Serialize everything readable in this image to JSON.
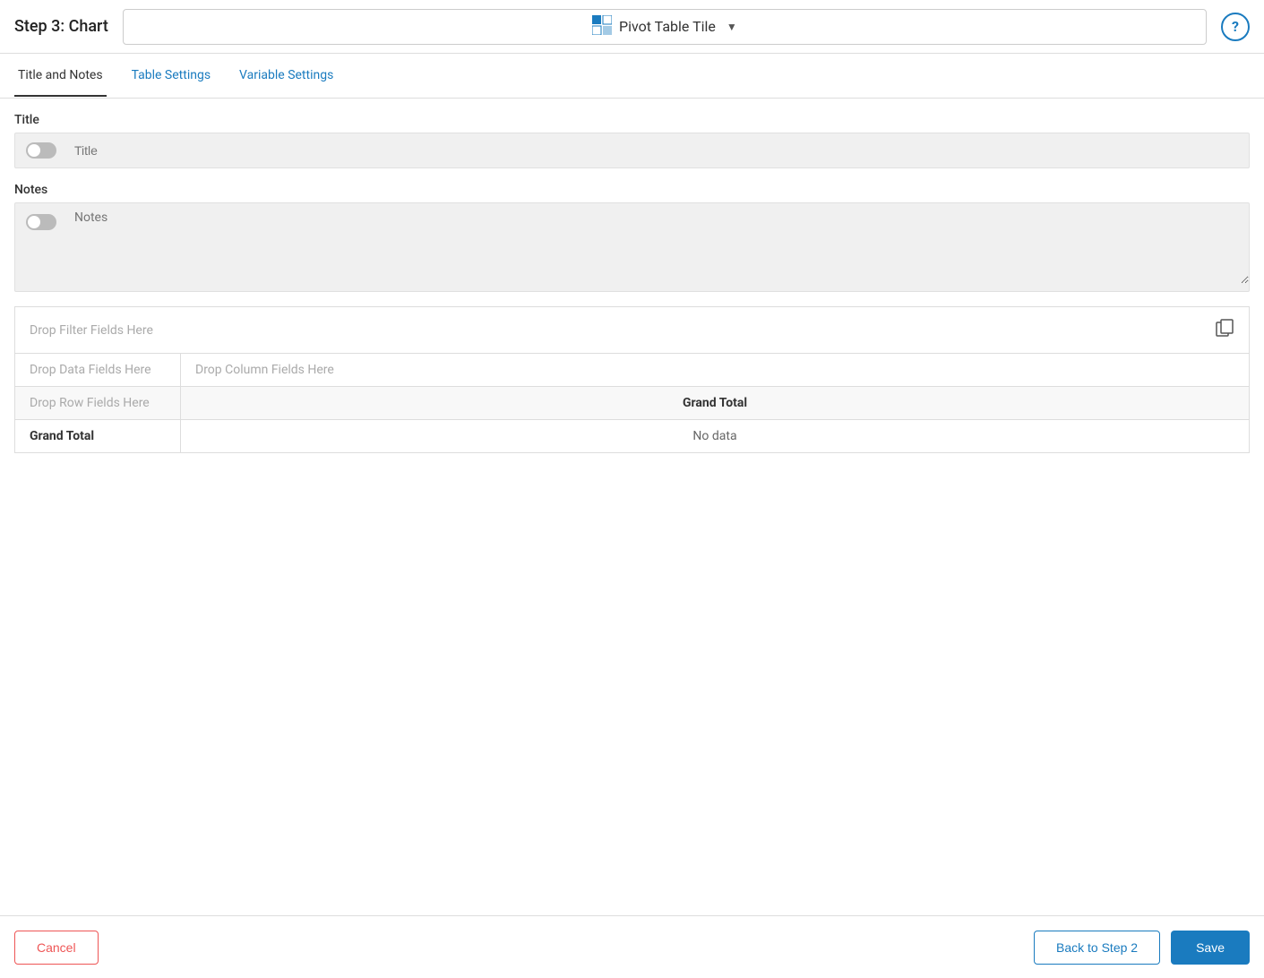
{
  "header": {
    "step_title": "Step 3: Chart",
    "tile_name": "Pivot Table Tile",
    "help_label": "?"
  },
  "tabs": [
    {
      "id": "title-notes",
      "label": "Title and Notes",
      "active": true
    },
    {
      "id": "table-settings",
      "label": "Table Settings",
      "active": false
    },
    {
      "id": "variable-settings",
      "label": "Variable Settings",
      "active": false
    }
  ],
  "title_section": {
    "label": "Title",
    "placeholder": "Title"
  },
  "notes_section": {
    "label": "Notes",
    "placeholder": "Notes"
  },
  "pivot_table": {
    "filter_drop": "Drop Filter Fields Here",
    "data_drop": "Drop Data Fields Here",
    "column_drop": "Drop Column Fields Here",
    "row_drop": "Drop Row Fields Here",
    "grand_total_header": "Grand Total",
    "grand_total_label": "Grand Total",
    "no_data": "No data"
  },
  "footer": {
    "cancel_label": "Cancel",
    "back_label": "Back to Step 2",
    "save_label": "Save"
  }
}
